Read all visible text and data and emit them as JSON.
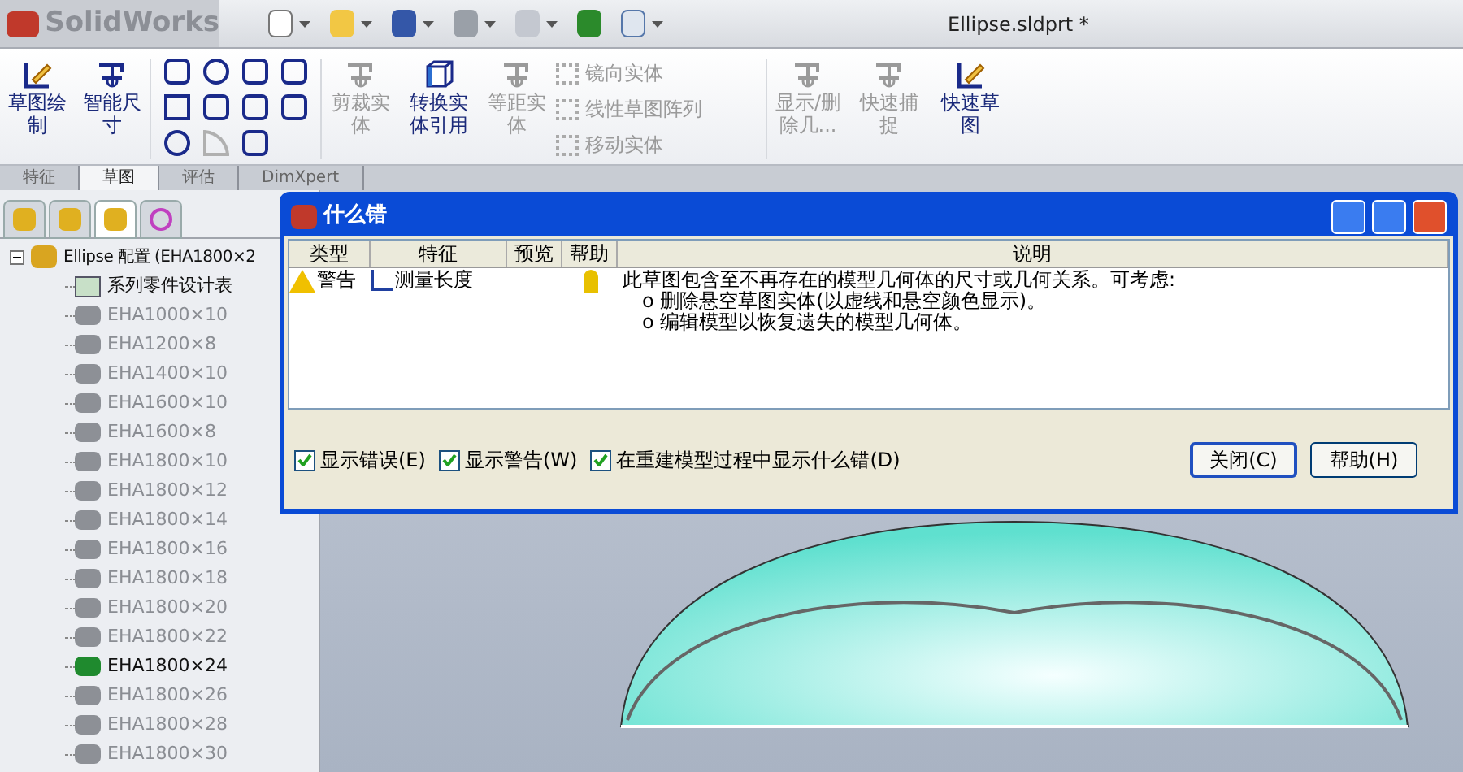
{
  "app": {
    "logo": "SolidWorks"
  },
  "window": {
    "title": "Ellipse.sldprt *"
  },
  "ribbon": {
    "large_buttons": [
      {
        "label": "草图绘制",
        "disabled": false
      },
      {
        "label": "智能尺寸",
        "disabled": false
      }
    ],
    "tool_buttons": [
      {
        "label": "剪裁实体",
        "disabled": true
      },
      {
        "label": "转换实体引用",
        "disabled": false
      },
      {
        "label": "等距实体",
        "disabled": true
      }
    ],
    "small_buttons": [
      {
        "label": "镜向实体",
        "disabled": true
      },
      {
        "label": "线性草图阵列",
        "disabled": true
      },
      {
        "label": "移动实体",
        "disabled": true
      }
    ],
    "right_buttons": [
      {
        "label": "显示/删除几...",
        "disabled": true
      },
      {
        "label": "快速捕捉",
        "disabled": true
      },
      {
        "label": "快速草图",
        "disabled": false
      }
    ]
  },
  "tabs": [
    {
      "label": "特征",
      "selected": false
    },
    {
      "label": "草图",
      "selected": true
    },
    {
      "label": "评估",
      "selected": false
    },
    {
      "label": "DimXpert",
      "selected": false
    }
  ],
  "panel_tabs": [
    {
      "selected": false
    },
    {
      "selected": false
    },
    {
      "selected": true
    },
    {
      "selected": false
    }
  ],
  "tree": {
    "root": "Ellipse 配置 (EHA1800×2",
    "expanded": true,
    "children": [
      {
        "label": "系列零件设计表",
        "kind": "table",
        "active": true
      },
      {
        "label": "EHA1000×10",
        "kind": "config",
        "active": false
      },
      {
        "label": "EHA1200×8",
        "kind": "config",
        "active": false
      },
      {
        "label": "EHA1400×10",
        "kind": "config",
        "active": false
      },
      {
        "label": "EHA1600×10",
        "kind": "config",
        "active": false
      },
      {
        "label": "EHA1600×8",
        "kind": "config",
        "active": false
      },
      {
        "label": "EHA1800×10",
        "kind": "config",
        "active": false
      },
      {
        "label": "EHA1800×12",
        "kind": "config",
        "active": false
      },
      {
        "label": "EHA1800×14",
        "kind": "config",
        "active": false
      },
      {
        "label": "EHA1800×16",
        "kind": "config",
        "active": false
      },
      {
        "label": "EHA1800×18",
        "kind": "config",
        "active": false
      },
      {
        "label": "EHA1800×20",
        "kind": "config",
        "active": false
      },
      {
        "label": "EHA1800×22",
        "kind": "config",
        "active": false
      },
      {
        "label": "EHA1800×24",
        "kind": "config",
        "active": true
      },
      {
        "label": "EHA1800×26",
        "kind": "config",
        "active": false
      },
      {
        "label": "EHA1800×28",
        "kind": "config",
        "active": false
      },
      {
        "label": "EHA1800×30",
        "kind": "config",
        "active": false
      }
    ]
  },
  "dialog": {
    "title": "什么错",
    "columns": [
      "类型",
      "特征",
      "预览",
      "帮助",
      "说明"
    ],
    "rows": [
      {
        "type": "警告",
        "feature": "测量长度",
        "description": "此草图包含至不再存在的模型几何体的尺寸或几何关系。可考虑:",
        "bullets": [
          "o 删除悬空草图实体(以虚线和悬空颜色显示)。",
          "o 编辑模型以恢复遗失的模型几何体。"
        ]
      }
    ],
    "checkboxes": [
      {
        "label": "显示错误(E)",
        "checked": true
      },
      {
        "label": "显示警告(W)",
        "checked": true
      },
      {
        "label": "在重建模型过程中显示什么错(D)",
        "checked": true
      }
    ],
    "buttons": [
      "关闭(C)",
      "帮助(H)"
    ]
  }
}
